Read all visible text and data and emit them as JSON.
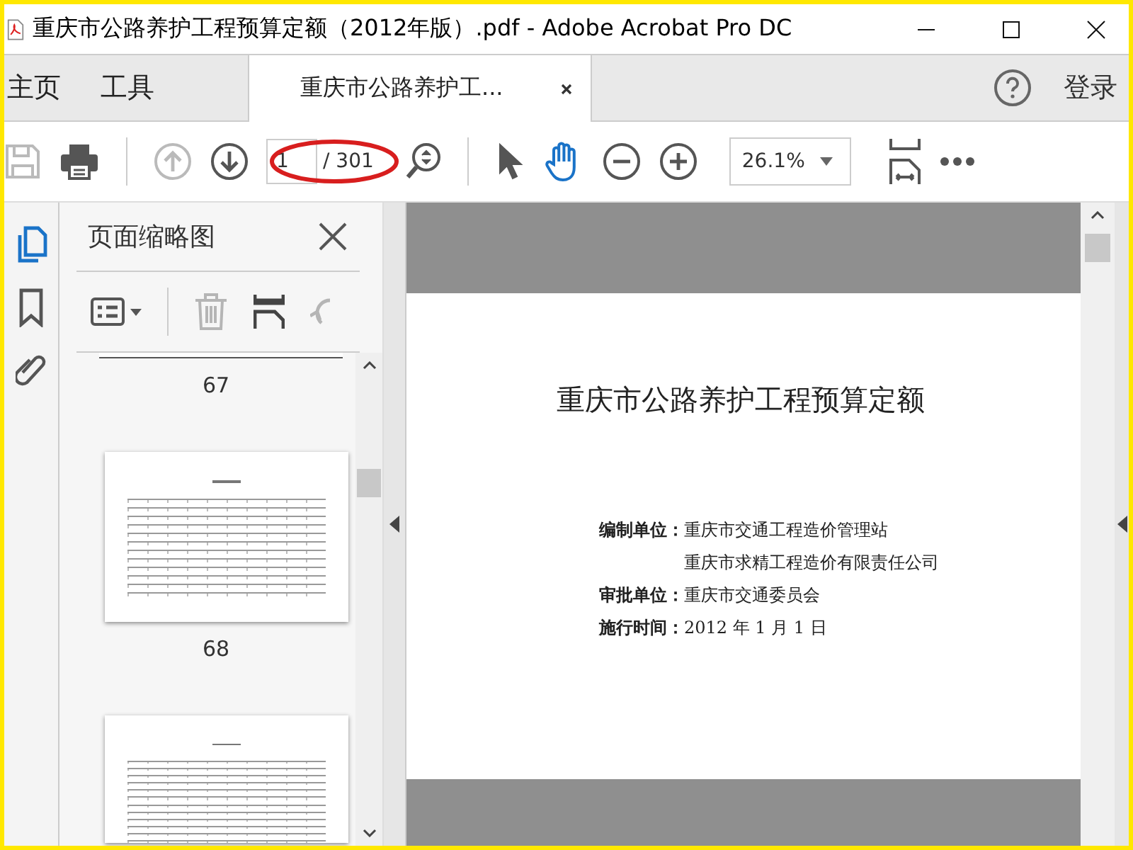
{
  "window": {
    "title": "重庆市公路养护工程预算定额（2012年版）.pdf - Adobe Acrobat Pro DC"
  },
  "tabs": [
    {
      "label": "主页",
      "selected": false
    },
    {
      "label": "工具",
      "selected": false
    },
    {
      "label": "重庆市公路养护工...",
      "selected": true
    }
  ],
  "account": {
    "login": "登录"
  },
  "toolbar": {
    "save_disabled": true,
    "prev_disabled": true,
    "next_disabled": false,
    "page_value": "1",
    "page_total": "/ 301",
    "tools": [
      {
        "kind": "select",
        "selected": false
      },
      {
        "kind": "hand",
        "selected": true
      }
    ],
    "zoom": "26.1%"
  },
  "sidebar": {
    "items": [
      {
        "kind": "pages",
        "selected": true
      },
      {
        "kind": "bookmarks",
        "selected": false
      },
      {
        "kind": "attachments",
        "selected": false
      }
    ]
  },
  "thumbnail_panel": {
    "title": "页面缩略图",
    "delete_disabled": true,
    "rotate_disabled": true,
    "thumbnails": [
      {
        "kind": "cut",
        "label": "67"
      },
      {
        "kind": "full",
        "label": "68"
      },
      {
        "kind": "partial"
      }
    ]
  },
  "document": {
    "title": "重庆市公路养护工程预算定额",
    "entries": [
      {
        "label": "编制单位：",
        "value": "重庆市交通工程造价管理站"
      },
      {
        "value": "重庆市求精工程造价有限责任公司"
      },
      {
        "label": "审批单位：",
        "value": "重庆市交通委员会"
      },
      {
        "label": "施行时间：",
        "value": "2012 年 1 月 1 日"
      }
    ]
  }
}
